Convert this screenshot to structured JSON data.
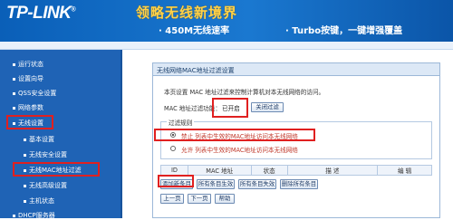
{
  "header": {
    "logo": "TP-LINK",
    "logo_mark": "®",
    "slogan": "领略无线新境界",
    "tag1": "· 450M无线速率",
    "tag2": "· Turbo按键，一键增强覆盖"
  },
  "sidebar": {
    "items": [
      {
        "label": "运行状态"
      },
      {
        "label": "设置向导"
      },
      {
        "label": "QSS安全设置"
      },
      {
        "label": "网络参数"
      },
      {
        "label": "无线设置"
      },
      {
        "label": "基本设置"
      },
      {
        "label": "无线安全设置"
      },
      {
        "label": "无线MAC地址过滤"
      },
      {
        "label": "无线高级设置"
      },
      {
        "label": "主机状态"
      },
      {
        "label": "DHCP服务器"
      }
    ]
  },
  "panel": {
    "title": "无线网络MAC地址过滤设置",
    "description": "本页设置 MAC 地址过滤来控制计算机对本无线网络的访问。",
    "status_label": "MAC 地址过滤功能：",
    "status_value": "已开启",
    "disable_button": "关闭过滤",
    "rules": {
      "legend": "过滤规则",
      "options": [
        {
          "label": "禁止  列表中生效的MAC地址访问本无线网络",
          "selected": true
        },
        {
          "label": "允许  列表中生效的MAC地址访问本无线网络",
          "selected": false
        }
      ]
    },
    "table": {
      "headers": [
        "ID",
        "MAC 地址",
        "状态",
        "描  述",
        "编  辑"
      ]
    },
    "buttons": {
      "add": "添加新条目",
      "enable_all": "所有条目生效",
      "disable_all": "所有条目失效",
      "delete_all": "删除所有条目"
    },
    "pager": {
      "prev": "上一页",
      "next": "下一页",
      "help": "帮助"
    }
  },
  "colors": {
    "highlight": "#e02020",
    "sidebar": "#1f63b5",
    "header": "#0a5fb8"
  }
}
